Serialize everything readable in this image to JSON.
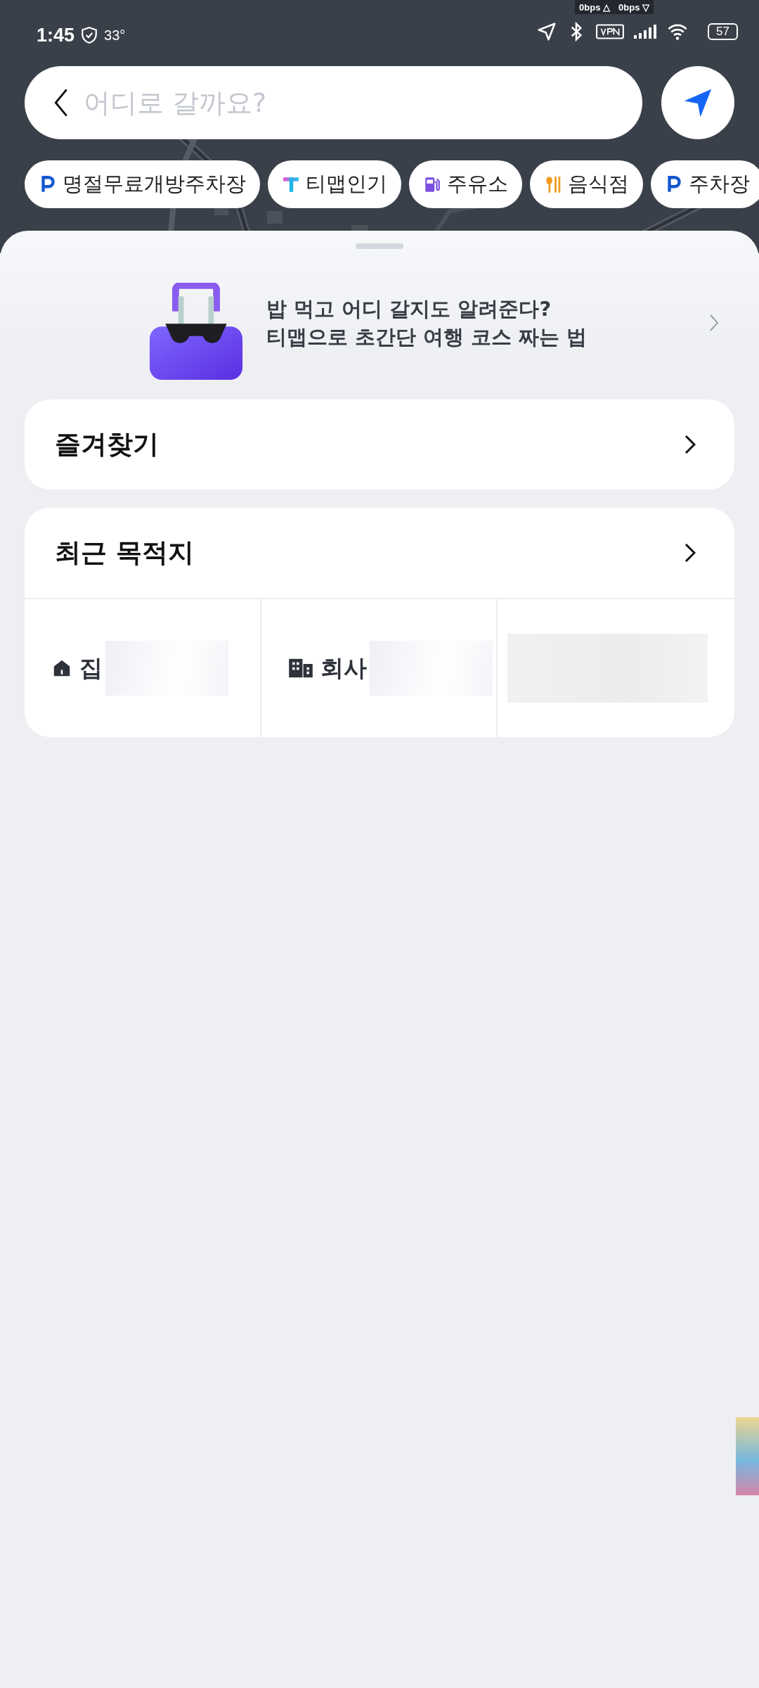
{
  "status_bar": {
    "time": "1:45",
    "temperature": "33°",
    "upload": "0bps △",
    "download": "0bps ▽",
    "battery": "57"
  },
  "search": {
    "placeholder": "어디로 갈까요?"
  },
  "chips": [
    {
      "kind": "parking",
      "label": "명절무료개방주차장"
    },
    {
      "kind": "tmap",
      "label": "티맵인기"
    },
    {
      "kind": "fuel",
      "label": "주유소"
    },
    {
      "kind": "food",
      "label": "음식점"
    },
    {
      "kind": "parking",
      "label": "주차장"
    }
  ],
  "banner": {
    "lines": [
      "밥 먹고 어디 갈지도 알려준다?",
      "티맵으로 초간단 여행 코스 짜는 법"
    ]
  },
  "favorites": {
    "title": "즐겨찾기"
  },
  "recent": {
    "title": "최근 목적지",
    "shortcuts": [
      {
        "kind": "home",
        "label": "집"
      },
      {
        "kind": "office",
        "label": "회사"
      },
      {
        "kind": "blank"
      }
    ]
  }
}
